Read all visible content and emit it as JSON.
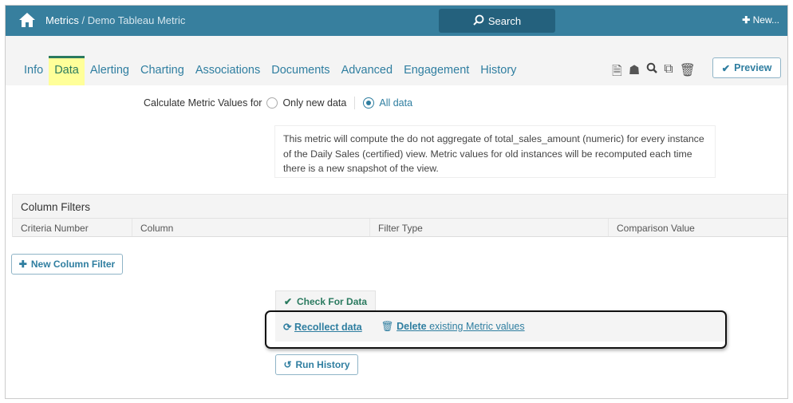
{
  "header": {
    "breadcrumb_root": "Metrics",
    "breadcrumb_current": "/ Demo Tableau Metric",
    "search_label": "Search",
    "new_label": "New..."
  },
  "tabs": [
    {
      "label": "Info"
    },
    {
      "label": "Data",
      "active": true
    },
    {
      "label": "Alerting"
    },
    {
      "label": "Charting"
    },
    {
      "label": "Associations"
    },
    {
      "label": "Documents"
    },
    {
      "label": "Advanced"
    },
    {
      "label": "Engagement"
    },
    {
      "label": "History"
    }
  ],
  "toolbar": {
    "icons": [
      "document-icon",
      "hierarchy-icon",
      "search-icon",
      "copy-icon",
      "trash-icon"
    ],
    "preview_label": "Preview"
  },
  "calc": {
    "label": "Calculate Metric Values for",
    "option_new": "Only new data",
    "option_all": "All data",
    "selected": "All data"
  },
  "description": "This metric will compute the do not aggregate of total_sales_amount (numeric) for every instance of the Daily Sales (certified) view. Metric values for old instances will be recomputed each time there is a new snapshot of the view.",
  "filters": {
    "title": "Column Filters",
    "columns": [
      "Criteria Number",
      "Column",
      "Filter Type",
      "Comparison Value"
    ],
    "new_button": "New Column Filter"
  },
  "actions": {
    "check": "Check For Data",
    "recollect": "Recollect data",
    "delete_bold": "Delete",
    "delete_rest": "existing Metric values",
    "run_history": "Run History"
  },
  "colors": {
    "header": "#377f9e",
    "accent": "#2f7ea0",
    "active_tab": "#ffff99"
  }
}
